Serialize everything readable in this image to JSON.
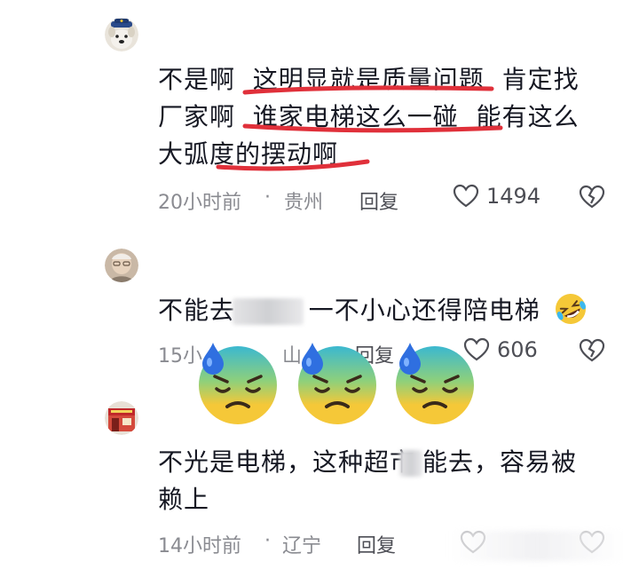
{
  "comments": [
    {
      "text_lines": [
        "不是啊  这明显就是质量问题  肯定找",
        "厂家啊  谁家电梯这么一碰  能有这么",
        "大弧度的摆动啊"
      ],
      "time": "20小时前",
      "sep": "·",
      "location": "贵州",
      "reply": "回复",
      "likes": "1494"
    },
    {
      "text_lines": [
        "不能去",
        "  一不小心还得陪电梯"
      ],
      "time": "15小",
      "sep": "",
      "location": "山",
      "reply": "回复",
      "likes": "606"
    },
    {
      "text_lines": [
        "不光是电梯，这种超市",
        "能去，容易被",
        "赖上"
      ],
      "time": "14小时前",
      "sep": "·",
      "location": "辽宁",
      "reply": "回复",
      "likes": ""
    }
  ],
  "icons": {
    "like": "heart-outline-icon",
    "dislike": "broken-heart-icon",
    "overlay_emoji": "downcast-sweat-face-emoji",
    "inline_emoji": "rolling-laughing-emoji"
  },
  "colors": {
    "underline": "#e0303a",
    "emoji_yellow": "#f5c838",
    "emoji_teal": "#3bb8d0",
    "drop_blue": "#2f6fe0"
  }
}
